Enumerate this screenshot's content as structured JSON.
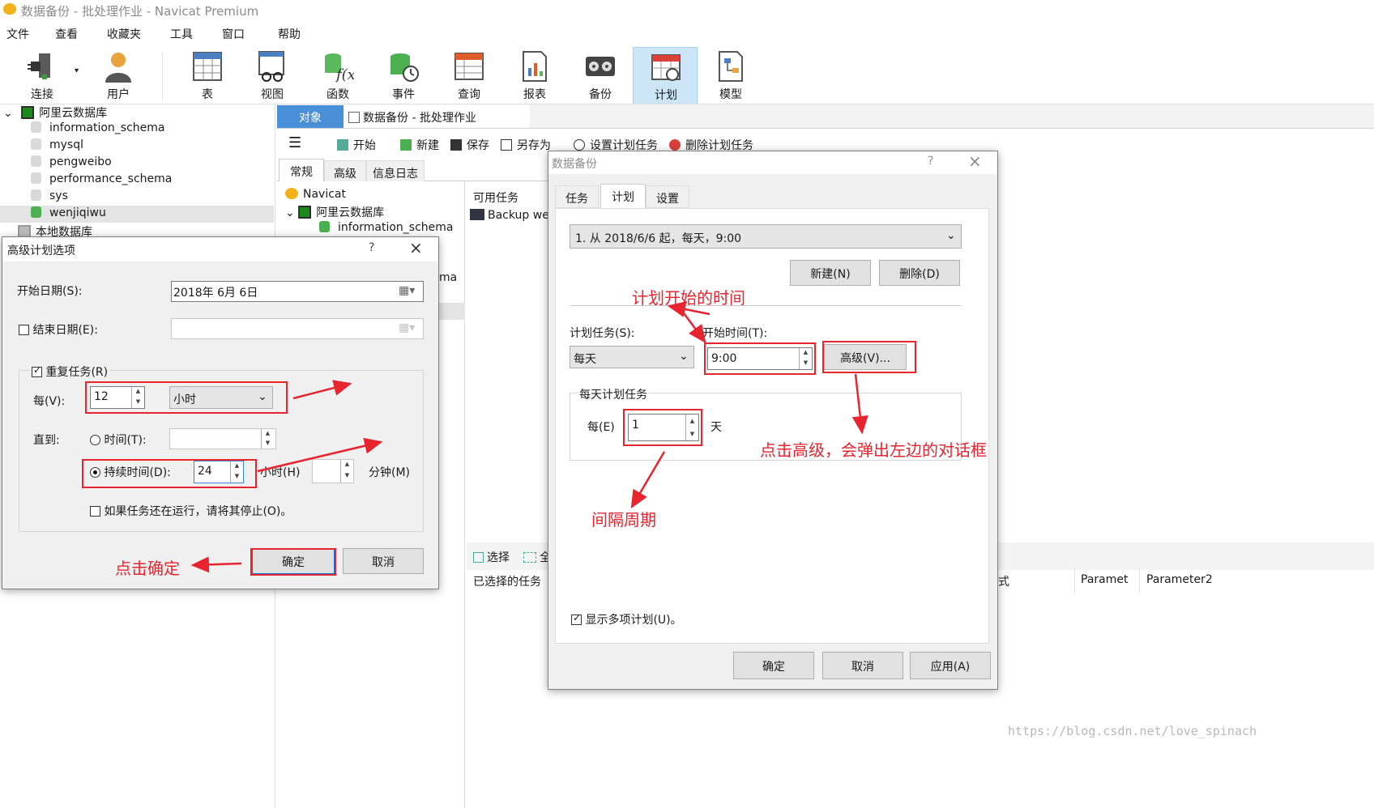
{
  "window": {
    "title": "数据备份 - 批处理作业 - Navicat Premium"
  },
  "menu": [
    "文件",
    "查看",
    "收藏夹",
    "工具",
    "窗口",
    "帮助"
  ],
  "toolbar": {
    "items": [
      "连接",
      "用户",
      "表",
      "视图",
      "函数",
      "事件",
      "查询",
      "报表",
      "备份",
      "计划",
      "模型"
    ],
    "active": "计划"
  },
  "tree": {
    "root": "阿里云数据库",
    "dbs": [
      "information_schema",
      "mysql",
      "pengweibo",
      "performance_schema",
      "sys",
      "wenjiqiwu"
    ],
    "local": "本地数据库"
  },
  "center": {
    "tab_object": "对象",
    "tab_doc": "数据备份 - 批处理作业",
    "actions": [
      "开始",
      "新建",
      "保存",
      "另存为",
      "设置计划任务",
      "删除计划任务"
    ],
    "subtabs": [
      "常规",
      "高级",
      "信息日志"
    ],
    "tree2": [
      "Navicat",
      "阿里云数据库",
      "information_schema"
    ],
    "partial_ma": "ma",
    "available_tasks_label": "可用任务",
    "available_task": "Backup wei",
    "select_label": "选择",
    "select_all_partial": "全",
    "selected_tasks_label": "已选择的任务",
    "col_partial": "式",
    "col_param": "Paramet",
    "col_param2": "Parameter2"
  },
  "advdlg": {
    "title": "高级计划选项",
    "help": "?",
    "close": "×",
    "start_date_label": "开始日期(S):",
    "start_date_value": "2018年  6月  6日",
    "end_date_label": "结束日期(E):",
    "repeat_label": "重复任务(R)",
    "every_label": "每(V):",
    "every_value": "12",
    "unit_value": "小时",
    "until_label": "直到:",
    "time_option": "时间(T):",
    "duration_option": "持续时间(D):",
    "duration_value": "24",
    "hours_label": "小时(H)",
    "minutes_label": "分钟(M)",
    "stop_label": "如果任务还在运行，请将其停止(O)。",
    "ok": "确定",
    "cancel": "取消"
  },
  "bakdlg": {
    "title": "数据备份",
    "help": "?",
    "close": "×",
    "tabs": [
      "任务",
      "计划",
      "设置"
    ],
    "schedule_value": "1. 从 2018/6/6 起，每天，9:00",
    "new_btn": "新建(N)",
    "delete_btn": "删除(D)",
    "task_label": "计划任务(S):",
    "task_value": "每天",
    "start_time_label": "开始时间(T):",
    "start_time_value": "9:00",
    "advanced_btn": "高级(V)...",
    "daily_group": "每天计划任务",
    "every_label": "每(E)",
    "every_value": "1",
    "day_unit": "天",
    "show_multi": "显示多项计划(U)。",
    "ok": "确定",
    "cancel": "取消",
    "apply": "应用(A)"
  },
  "annotations": {
    "start_time": "计划开始的时间",
    "click_advanced": "点击高级，会弹出左边的对话框",
    "interval": "间隔周期",
    "click_ok": "点击确定"
  },
  "watermark": "https://blog.csdn.net/love_spinach",
  "colors": {
    "annotation": "#e8242f",
    "active_tab": "#4a90d9",
    "selected_toolbar": "#cde6f7"
  }
}
